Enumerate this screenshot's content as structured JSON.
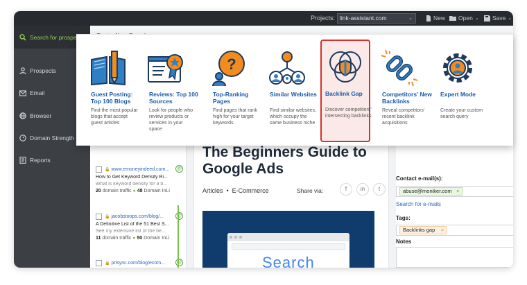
{
  "window": {
    "projects_label": "Projects:",
    "project_value": "link-assistant.com",
    "new_label": "New",
    "open_label": "Open",
    "save_label": "Save"
  },
  "sidebar": {
    "items": [
      {
        "label": "Search for prospects",
        "icon": "search-icon"
      },
      {
        "label": "Prospects",
        "icon": "user-icon"
      },
      {
        "label": "Email",
        "icon": "envelope-icon"
      },
      {
        "label": "Browser",
        "icon": "globe-icon"
      },
      {
        "label": "Domain Strength",
        "icon": "gauge-icon"
      },
      {
        "label": "Reports",
        "icon": "report-icon"
      }
    ]
  },
  "toolbar": {
    "new_search_label": "Start a New Search"
  },
  "search_types": [
    {
      "title": "Guest Posting: Top 100 Blogs",
      "desc": "Find the most popular blogs that accept guest articles",
      "icon": "book-pencil-icon"
    },
    {
      "title": "Reviews: Top 100 Sources",
      "desc": "Look for people who review products or services in your space",
      "icon": "review-award-icon"
    },
    {
      "title": "Top-Ranking Pages",
      "desc": "Find pages that rank high for your target keywords",
      "icon": "question-bubble-icon"
    },
    {
      "title": "Similar Websites",
      "desc": "Find similar websites, which occupy the same business niche",
      "icon": "people-network-icon"
    },
    {
      "title": "Backlink Gap",
      "desc": "Discover competitors' intersecting backlinks",
      "icon": "venn-shield-icon",
      "selected": true
    },
    {
      "title": "Competitors' New Backlinks",
      "desc": "Reveal competitors' recent backlink acquisitions",
      "icon": "chain-link-icon"
    },
    {
      "title": "Expert Mode",
      "desc": "Create your custom search query",
      "icon": "gear-user-icon"
    }
  ],
  "prospects": [
    {
      "url": "www.emoneyindeed.com...",
      "title": "How to Get Keyword Density Ri...",
      "desc": "What is keyword density for a b...",
      "traffic": "20",
      "traffic_label": "domain traffic",
      "inlinks": "48",
      "inlinks_label": "Domain InLi"
    },
    {
      "url": "jacobstoops.com/blog/...",
      "title": "A Definitive List of the 51 Best S...",
      "desc": "See my extensive list of the be...",
      "traffic": "11",
      "traffic_label": "domain traffic",
      "inlinks": "50",
      "inlinks_label": "Domain InLi"
    },
    {
      "url": "prisync.com/blog/ecom..."
    }
  ],
  "article": {
    "title": "The Beginners Guide to Google Ads",
    "categories": [
      "Articles",
      "E-Commerce"
    ],
    "share_label": "Share via:",
    "hero_word": "Search"
  },
  "details": {
    "contact_label": "Contact e-mail(s):",
    "email": "abuse@moniker.com",
    "search_emails": "Search for e-mails",
    "tags_label": "Tags:",
    "tag": "Backlinks gap",
    "notes_label": "Notes"
  },
  "colors": {
    "accent_green": "#8fcf55",
    "link_blue": "#1a5aa6",
    "selected_red": "#d9312b",
    "icon_orange": "#f28c1e"
  }
}
